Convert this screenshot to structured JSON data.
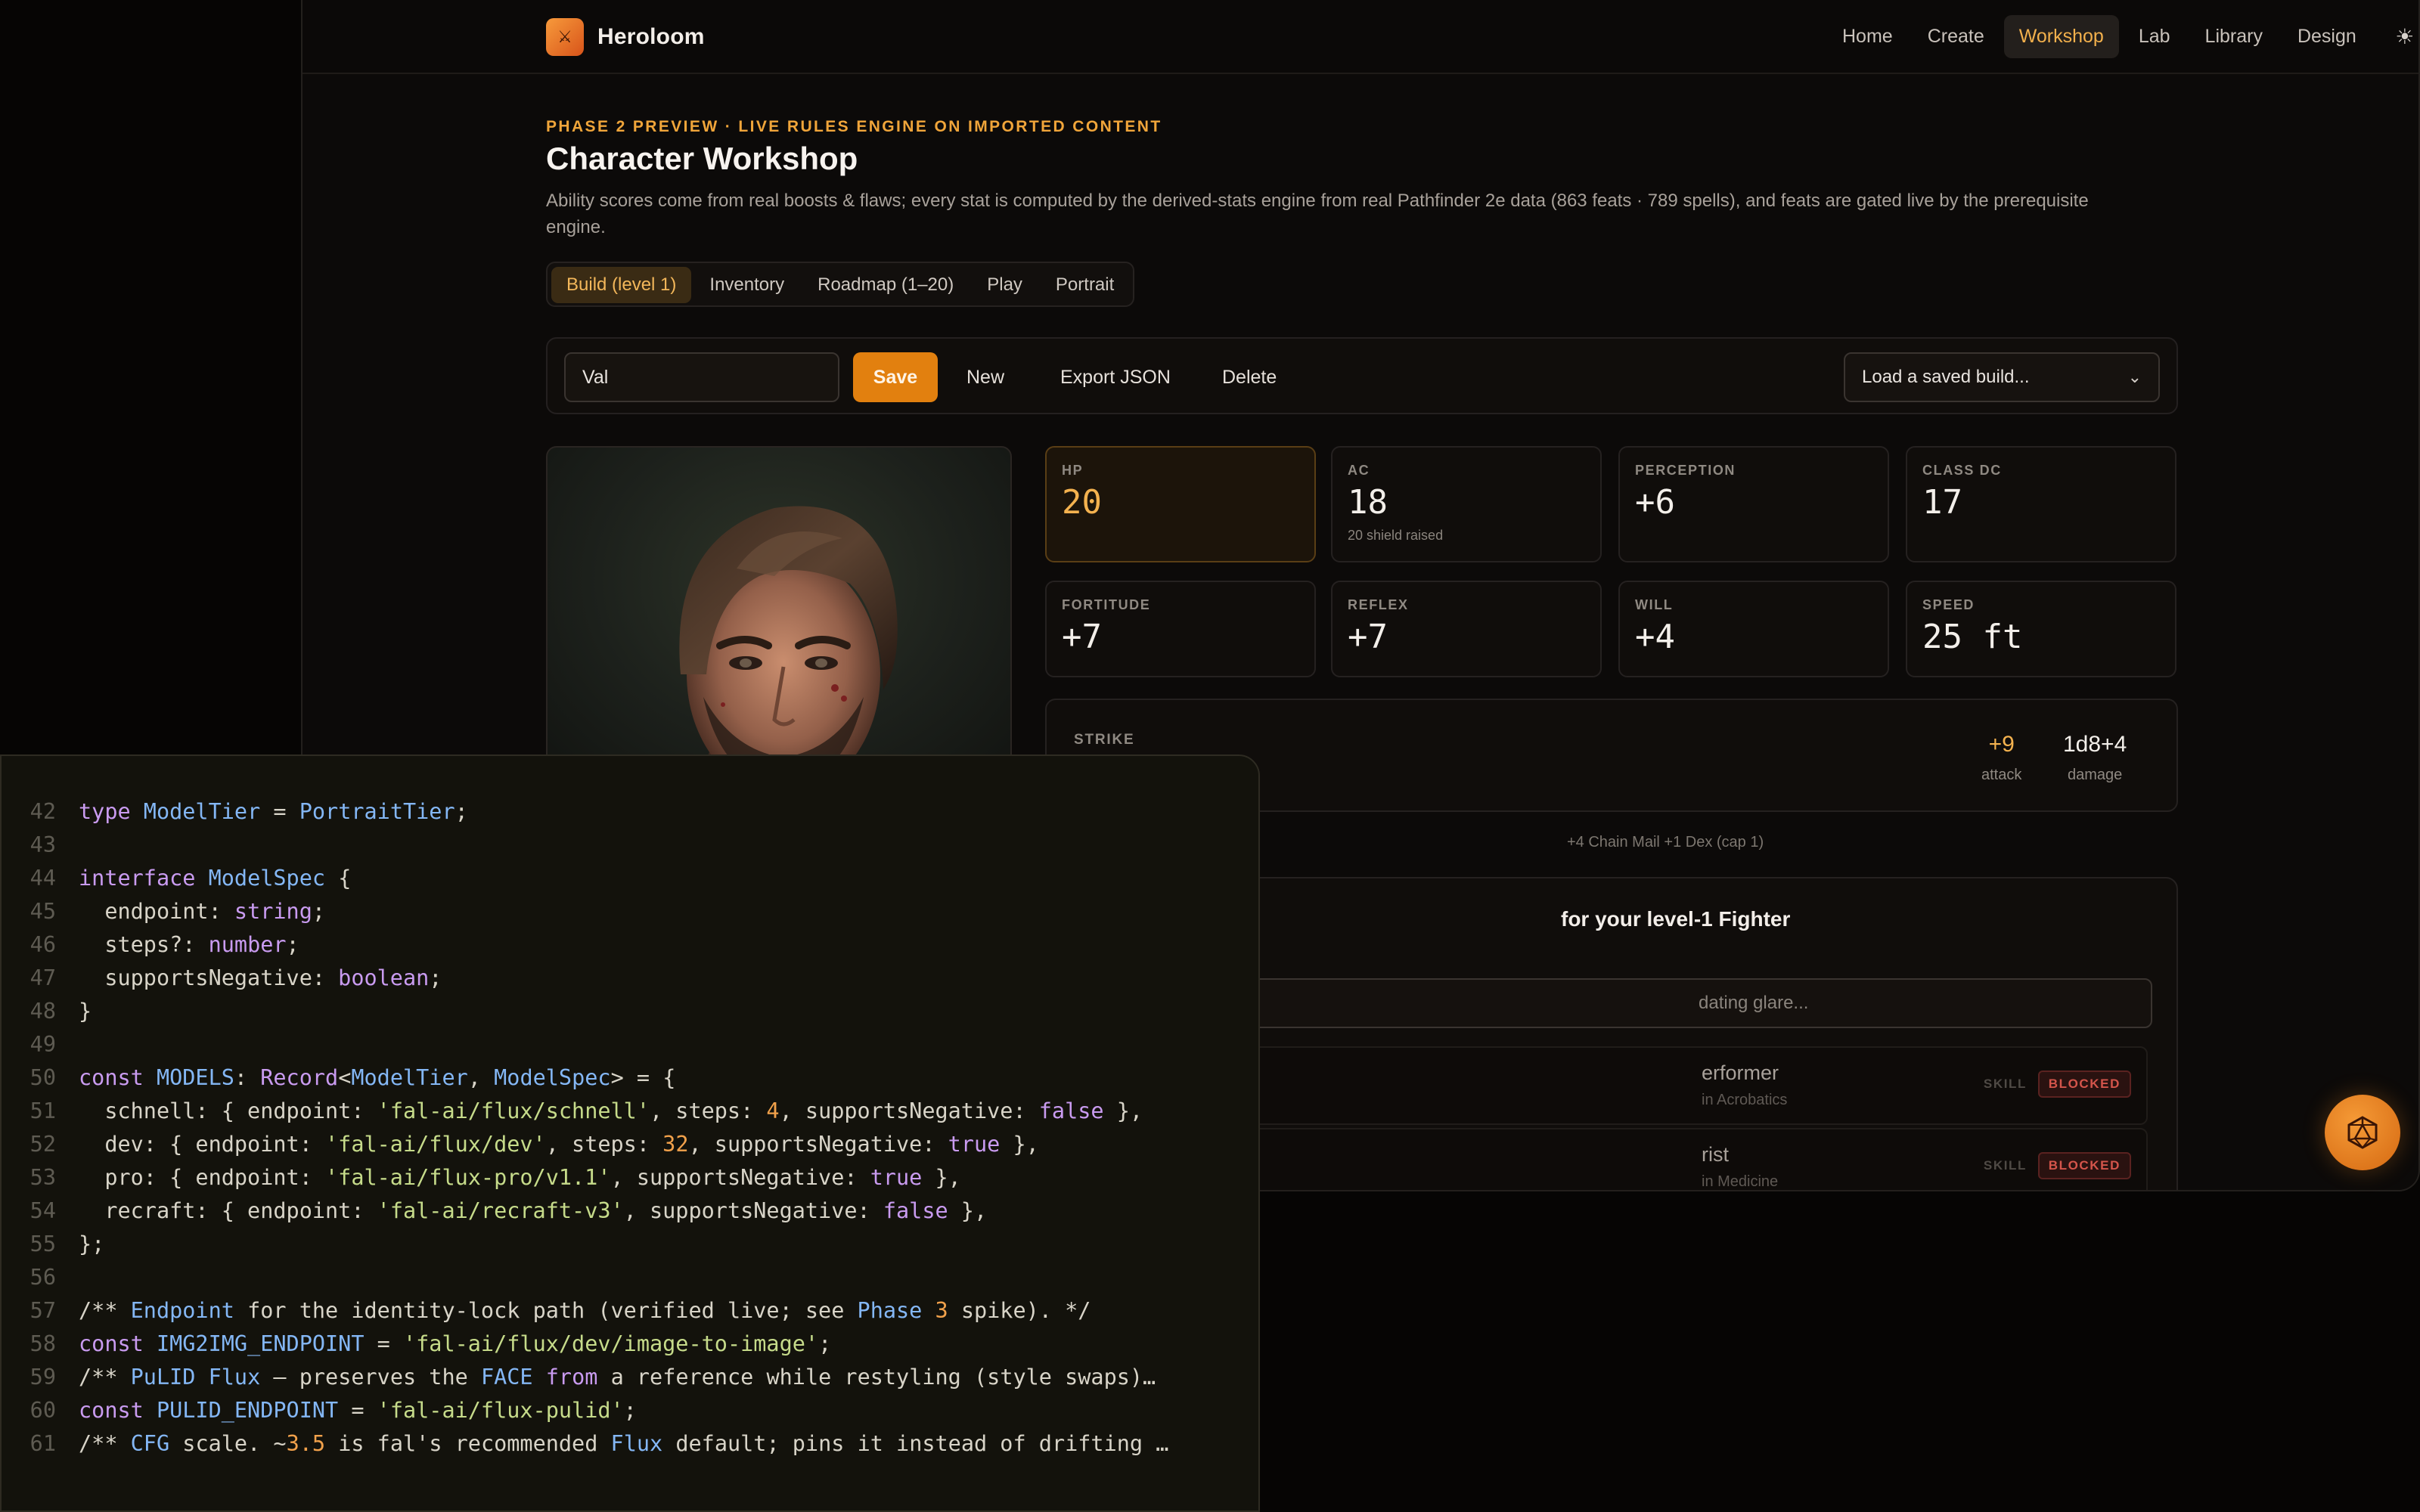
{
  "app": {
    "brand_name": "Heroloom",
    "nav": [
      {
        "label": "Home",
        "active": false
      },
      {
        "label": "Create",
        "active": false
      },
      {
        "label": "Workshop",
        "active": true
      },
      {
        "label": "Lab",
        "active": false
      },
      {
        "label": "Library",
        "active": false
      },
      {
        "label": "Design",
        "active": false
      }
    ],
    "theme_icon": "sun-icon"
  },
  "page": {
    "eyebrow": "PHASE 2 PREVIEW · LIVE RULES ENGINE ON IMPORTED CONTENT",
    "title": "Character Workshop",
    "description": "Ability scores come from real boosts & flaws; every stat is computed by the derived-stats engine from real Pathfinder 2e data (863 feats · 789 spells), and feats are gated live by the prerequisite engine."
  },
  "tabs": [
    {
      "label": "Build (level 1)",
      "active": true
    },
    {
      "label": "Inventory",
      "active": false
    },
    {
      "label": "Roadmap (1–20)",
      "active": false
    },
    {
      "label": "Play",
      "active": false
    },
    {
      "label": "Portrait",
      "active": false
    }
  ],
  "toolbar": {
    "name_value": "Val",
    "save_label": "Save",
    "new_label": "New",
    "export_label": "Export JSON",
    "delete_label": "Delete",
    "load_placeholder": "Load a saved build..."
  },
  "stats": [
    {
      "label": "HP",
      "value": "20",
      "sub": "",
      "highlight": true
    },
    {
      "label": "AC",
      "value": "18",
      "sub": "20 shield raised",
      "highlight": false
    },
    {
      "label": "PERCEPTION",
      "value": "+6",
      "sub": "",
      "highlight": false
    },
    {
      "label": "CLASS DC",
      "value": "17",
      "sub": "",
      "highlight": false
    },
    {
      "label": "FORTITUDE",
      "value": "+7",
      "sub": "",
      "highlight": false
    },
    {
      "label": "REFLEX",
      "value": "+7",
      "sub": "",
      "highlight": false
    },
    {
      "label": "WILL",
      "value": "+4",
      "sub": "",
      "highlight": false
    },
    {
      "label": "SPEED",
      "value": "25 ft",
      "sub": "",
      "highlight": false
    }
  ],
  "strike": {
    "label": "STRIKE",
    "attack_value": "+9",
    "attack_caption": "attack",
    "damage_value": "1d8+4",
    "damage_caption": "damage"
  },
  "ac_note": "+4 Chain Mail +1 Dex (cap 1)",
  "feats": {
    "title_fragment": "for your level-1 Fighter",
    "search_placeholder": "dating glare...",
    "rows": [
      {
        "name": "erformer",
        "requirement": "in Acrobatics",
        "type": "SKILL",
        "status": "BLOCKED"
      },
      {
        "name": "rist",
        "requirement": "in Medicine",
        "type": "SKILL",
        "status": "BLOCKED"
      }
    ]
  },
  "code": {
    "lines": [
      {
        "n": "42",
        "tokens": [
          [
            "kw",
            "type "
          ],
          [
            "ty",
            "ModelTier"
          ],
          [
            "pl",
            " = "
          ],
          [
            "ty",
            "PortraitTier"
          ],
          [
            "pl",
            ";"
          ]
        ]
      },
      {
        "n": "43",
        "tokens": []
      },
      {
        "n": "44",
        "tokens": [
          [
            "kw",
            "interface "
          ],
          [
            "ty",
            "ModelSpec"
          ],
          [
            "pl",
            " {"
          ]
        ]
      },
      {
        "n": "45",
        "tokens": [
          [
            "pl",
            "  endpoint: "
          ],
          [
            "kw",
            "string"
          ],
          [
            "pl",
            ";"
          ]
        ]
      },
      {
        "n": "46",
        "tokens": [
          [
            "pl",
            "  steps?: "
          ],
          [
            "kw",
            "number"
          ],
          [
            "pl",
            ";"
          ]
        ]
      },
      {
        "n": "47",
        "tokens": [
          [
            "pl",
            "  supportsNegative: "
          ],
          [
            "kw",
            "boolean"
          ],
          [
            "pl",
            ";"
          ]
        ]
      },
      {
        "n": "48",
        "tokens": [
          [
            "pl",
            "}"
          ]
        ]
      },
      {
        "n": "49",
        "tokens": []
      },
      {
        "n": "50",
        "tokens": [
          [
            "kw",
            "const "
          ],
          [
            "ty",
            "MODELS"
          ],
          [
            "pl",
            ": "
          ],
          [
            "kw",
            "Record"
          ],
          [
            "pl",
            "<"
          ],
          [
            "ty",
            "ModelTier"
          ],
          [
            "pl",
            ", "
          ],
          [
            "ty",
            "ModelSpec"
          ],
          [
            "pl",
            "> = {"
          ]
        ]
      },
      {
        "n": "51",
        "tokens": [
          [
            "pl",
            "  schnell: { endpoint: "
          ],
          [
            "str",
            "'fal-ai/flux/schnell'"
          ],
          [
            "pl",
            ", steps: "
          ],
          [
            "num",
            "4"
          ],
          [
            "pl",
            ", supportsNegative: "
          ],
          [
            "kw",
            "false"
          ],
          [
            "pl",
            " },"
          ]
        ]
      },
      {
        "n": "52",
        "tokens": [
          [
            "pl",
            "  dev: { endpoint: "
          ],
          [
            "str",
            "'fal-ai/flux/dev'"
          ],
          [
            "pl",
            ", steps: "
          ],
          [
            "num",
            "32"
          ],
          [
            "pl",
            ", supportsNegative: "
          ],
          [
            "kw",
            "true"
          ],
          [
            "pl",
            " },"
          ]
        ]
      },
      {
        "n": "53",
        "tokens": [
          [
            "pl",
            "  pro: { endpoint: "
          ],
          [
            "str",
            "'fal-ai/flux-pro/v1.1'"
          ],
          [
            "pl",
            ", supportsNegative: "
          ],
          [
            "kw",
            "true"
          ],
          [
            "pl",
            " },"
          ]
        ]
      },
      {
        "n": "54",
        "tokens": [
          [
            "pl",
            "  recraft: { endpoint: "
          ],
          [
            "str",
            "'fal-ai/recraft-v3'"
          ],
          [
            "pl",
            ", supportsNegative: "
          ],
          [
            "kw",
            "false"
          ],
          [
            "pl",
            " },"
          ]
        ]
      },
      {
        "n": "55",
        "tokens": [
          [
            "pl",
            "};"
          ]
        ]
      },
      {
        "n": "56",
        "tokens": []
      },
      {
        "n": "57",
        "tokens": [
          [
            "pl",
            "/** "
          ],
          [
            "ty",
            "Endpoint"
          ],
          [
            "pl",
            " for the identity-lock path (verified live; see "
          ],
          [
            "ty",
            "Phase"
          ],
          [
            "pl",
            " "
          ],
          [
            "num",
            "3"
          ],
          [
            "pl",
            " spike). */"
          ]
        ]
      },
      {
        "n": "58",
        "tokens": [
          [
            "kw",
            "const "
          ],
          [
            "ty",
            "IMG2IMG_ENDPOINT"
          ],
          [
            "pl",
            " = "
          ],
          [
            "str",
            "'fal-ai/flux/dev/image-to-image'"
          ],
          [
            "pl",
            ";"
          ]
        ]
      },
      {
        "n": "59",
        "tokens": [
          [
            "pl",
            "/** "
          ],
          [
            "ty",
            "PuLID"
          ],
          [
            "pl",
            " "
          ],
          [
            "ty",
            "Flux"
          ],
          [
            "pl",
            " — preserves the "
          ],
          [
            "ty",
            "FACE"
          ],
          [
            "pl",
            " "
          ],
          [
            "kw",
            "from"
          ],
          [
            "pl",
            " a reference while restyling (style swaps)…"
          ]
        ]
      },
      {
        "n": "60",
        "tokens": [
          [
            "kw",
            "const "
          ],
          [
            "ty",
            "PULID_ENDPOINT"
          ],
          [
            "pl",
            " = "
          ],
          [
            "str",
            "'fal-ai/flux-pulid'"
          ],
          [
            "pl",
            ";"
          ]
        ]
      },
      {
        "n": "61",
        "tokens": [
          [
            "pl",
            "/** "
          ],
          [
            "ty",
            "CFG"
          ],
          [
            "pl",
            " scale. ~"
          ],
          [
            "num",
            "3.5"
          ],
          [
            "pl",
            " is fal's recommended "
          ],
          [
            "ty",
            "Flux"
          ],
          [
            "pl",
            " default; pins it instead of drifting …"
          ]
        ]
      }
    ]
  },
  "colors": {
    "accent": "#e2800f",
    "highlight_gold": "#f4b24f",
    "blocked_red": "#d4554b"
  }
}
